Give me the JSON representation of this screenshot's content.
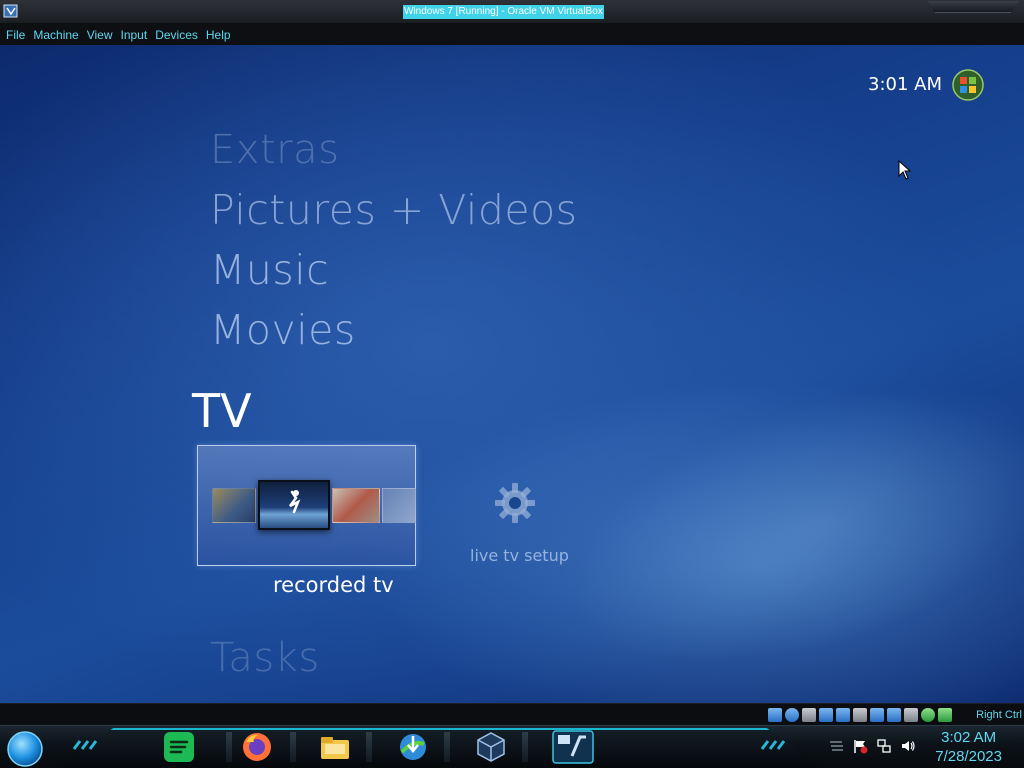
{
  "window": {
    "title": "Windows 7 [Running] - Oracle VM VirtualBox"
  },
  "menubar": {
    "items": [
      {
        "label": "File"
      },
      {
        "label": "Machine"
      },
      {
        "label": "View"
      },
      {
        "label": "Input"
      },
      {
        "label": "Devices"
      },
      {
        "label": "Help"
      }
    ]
  },
  "media_center": {
    "clock": "3:01 AM",
    "menu_items": [
      "Extras",
      "Pictures + Videos",
      "Music",
      "Movies"
    ],
    "selected_menu": "TV",
    "tasks_label": "Tasks",
    "tiles": [
      {
        "label": "recorded tv",
        "icon": "recorded-tv-thumbnails",
        "selected": true
      },
      {
        "label": "live tv setup",
        "icon": "gear-icon",
        "selected": false
      }
    ]
  },
  "statusbar": {
    "icons": [
      "hard-disk",
      "optical-drive",
      "audio",
      "network",
      "usb",
      "shared-folders",
      "display",
      "video-capture",
      "vrde",
      "mouse-integration",
      "guest-additions"
    ],
    "host_key": "Right Ctrl"
  },
  "taskbar": {
    "apps": [
      "start-orb",
      "spotify",
      "firefox",
      "file-explorer",
      "internet-download-manager",
      "virtualbox",
      "windows-7-vm"
    ],
    "tray_icons": [
      "action-center-flag",
      "network",
      "volume"
    ],
    "clock_time": "3:02 AM",
    "clock_date": "7/28/2023"
  },
  "colors": {
    "accent_cyan": "#5fd8f0",
    "title_highlight": "#3fd2e8",
    "mc_background": "#16418f",
    "spotify": "#1db954",
    "firefox": "#ff7139"
  }
}
